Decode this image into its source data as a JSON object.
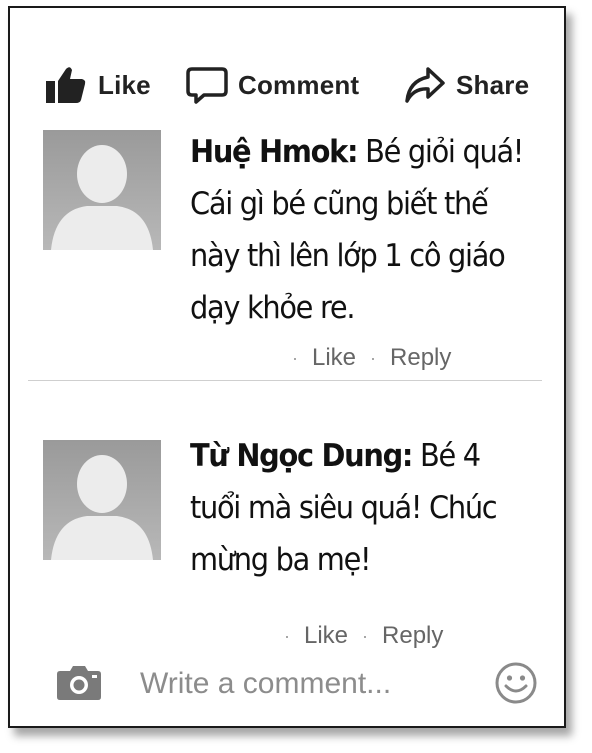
{
  "actions": {
    "like_label": "Like",
    "comment_label": "Comment",
    "share_label": "Share"
  },
  "comments": [
    {
      "author": "Huệ Hmok:",
      "text": "Bé giỏi quá! Cái gì bé cũng biết thế này thì lên lớp 1 cô giáo dạy khỏe re.",
      "like_label": "Like",
      "reply_label": "Reply"
    },
    {
      "author": "Từ Ngọc Dung:",
      "text": "Bé 4 tuổi mà siêu quá! Chúc mừng ba mẹ!",
      "like_label": "Like",
      "reply_label": "Reply"
    }
  ],
  "composer": {
    "placeholder": "Write a comment..."
  },
  "icons": {
    "like": "thumbs-up-icon",
    "comment": "speech-bubble-icon",
    "share": "share-arrow-icon",
    "camera": "camera-icon",
    "emoji": "smiley-icon"
  }
}
